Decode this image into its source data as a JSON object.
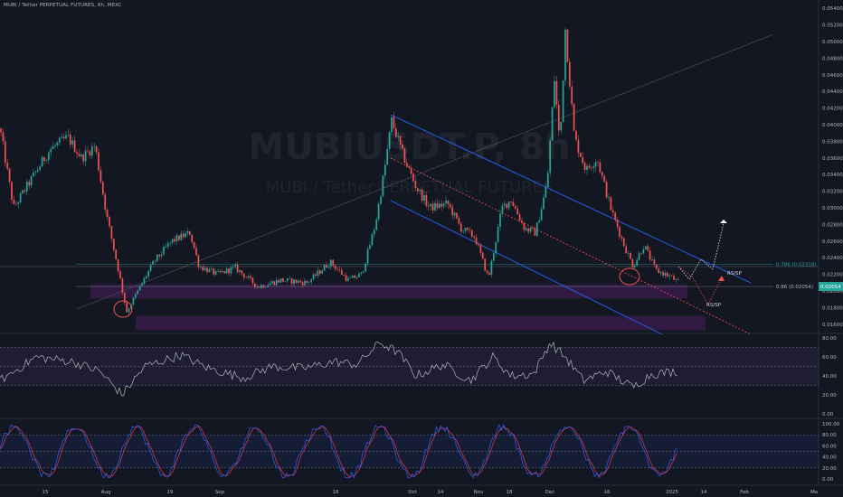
{
  "header": {
    "title": "MUBI / Tether PERPETUAL FUTURES, 8h, MEXC"
  },
  "watermark": {
    "symbol": "MUBIUSDT.P, 8h",
    "name": "MUBI / Tether PERPETUAL FUTURES"
  },
  "colors": {
    "up": "#26a69a",
    "down": "#ef5350",
    "channel": "#2962ff",
    "zone": "#9c27b0",
    "fib": "#787b86",
    "rsi": "#b2b5be",
    "stoch_k": "#2962ff",
    "stoch_d": "#f23645",
    "price_tag": "#26a69a"
  },
  "chart_data": [
    {
      "type": "candlestick",
      "symbol": "MUBI / Tether PERPETUAL FUTURES",
      "interval": "8h",
      "ylim": [
        0.015,
        0.055
      ],
      "y_ticks": [
        "0.01400",
        "0.01600",
        "0.01800",
        "0.02000",
        "0.02200",
        "0.02400",
        "0.02600",
        "0.02800",
        "0.03000",
        "0.03200",
        "0.03400",
        "0.03600",
        "0.03800",
        "0.04000",
        "0.04200",
        "0.04400",
        "0.04600",
        "0.04800",
        "0.05000",
        "0.05200",
        "0.05400"
      ],
      "x_ticks": [
        "15",
        "Aug",
        "19",
        "Sep",
        "16",
        "Oct",
        "14",
        "Nov",
        "18",
        "Dec",
        "16",
        "2025",
        "14",
        "Feb",
        "Ma"
      ],
      "price_path": [
        [
          0,
          0.0395
        ],
        [
          15,
          0.03
        ],
        [
          35,
          0.0335
        ],
        [
          55,
          0.037
        ],
        [
          75,
          0.0385
        ],
        [
          90,
          0.036
        ],
        [
          105,
          0.0375
        ],
        [
          118,
          0.029
        ],
        [
          130,
          0.023
        ],
        [
          140,
          0.0175
        ],
        [
          155,
          0.0205
        ],
        [
          170,
          0.0235
        ],
        [
          190,
          0.026
        ],
        [
          210,
          0.027
        ],
        [
          220,
          0.023
        ],
        [
          240,
          0.022
        ],
        [
          260,
          0.0228
        ],
        [
          285,
          0.0205
        ],
        [
          310,
          0.0213
        ],
        [
          340,
          0.021
        ],
        [
          365,
          0.0235
        ],
        [
          385,
          0.0213
        ],
        [
          400,
          0.022
        ],
        [
          415,
          0.028
        ],
        [
          425,
          0.0345
        ],
        [
          433,
          0.0405
        ],
        [
          445,
          0.0365
        ],
        [
          460,
          0.0325
        ],
        [
          475,
          0.03
        ],
        [
          495,
          0.0305
        ],
        [
          510,
          0.0275
        ],
        [
          525,
          0.0265
        ],
        [
          540,
          0.0215
        ],
        [
          555,
          0.03
        ],
        [
          565,
          0.031
        ],
        [
          580,
          0.0275
        ],
        [
          592,
          0.027
        ],
        [
          605,
          0.033
        ],
        [
          613,
          0.0455
        ],
        [
          619,
          0.0375
        ],
        [
          625,
          0.0515
        ],
        [
          635,
          0.0385
        ],
        [
          648,
          0.0345
        ],
        [
          660,
          0.036
        ],
        [
          675,
          0.03
        ],
        [
          690,
          0.0255
        ],
        [
          700,
          0.023
        ],
        [
          712,
          0.0255
        ],
        [
          725,
          0.0225
        ],
        [
          740,
          0.0218
        ],
        [
          750,
          0.021
        ]
      ],
      "fib_levels": [
        {
          "label": "0.786 (0.02318)",
          "value": 0.02318
        },
        {
          "label": "0.86 (0.02054)",
          "value": 0.02054
        }
      ],
      "zones": [
        {
          "top": 0.0208,
          "bottom": 0.0191
        },
        {
          "top": 0.017,
          "bottom": 0.0153
        }
      ],
      "annotations": [
        "RS/SP",
        "RS/SP"
      ],
      "last_price_label": "0.02054"
    },
    {
      "type": "line",
      "name": "RSI",
      "ylim": [
        0,
        80
      ],
      "y_ticks": [
        "0.00",
        "20.00",
        "40.00",
        "60.00",
        "80.00"
      ],
      "levels": [
        70,
        50,
        30
      ]
    },
    {
      "type": "line",
      "name": "Stochastic",
      "ylim": [
        0,
        100
      ],
      "y_ticks": [
        "0.00",
        "20.00",
        "40.00",
        "60.00",
        "80.00",
        "100.00"
      ],
      "levels": [
        80,
        50,
        20
      ]
    }
  ]
}
